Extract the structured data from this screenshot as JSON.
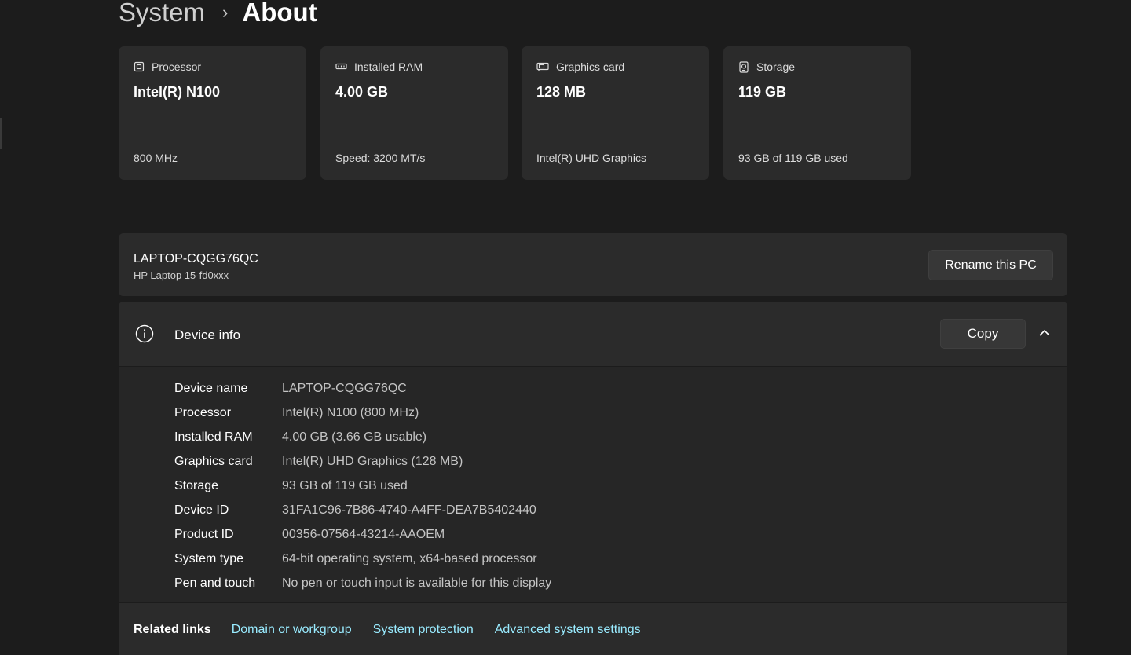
{
  "breadcrumb": {
    "parent": "System",
    "separator": "›",
    "current": "About"
  },
  "cards": [
    {
      "icon": "processor-icon",
      "title": "Processor",
      "value": "Intel(R) N100",
      "sub": "800 MHz"
    },
    {
      "icon": "ram-icon",
      "title": "Installed RAM",
      "value": "4.00 GB",
      "sub": "Speed: 3200 MT/s"
    },
    {
      "icon": "graphics-card-icon",
      "title": "Graphics card",
      "value": "128 MB",
      "sub": "Intel(R) UHD Graphics"
    },
    {
      "icon": "storage-icon",
      "title": "Storage",
      "value": "119 GB",
      "sub": "93 GB of 119 GB used"
    }
  ],
  "pc": {
    "name": "LAPTOP-CQGG76QC",
    "model": "HP Laptop 15-fd0xxx",
    "rename_label": "Rename this PC"
  },
  "device_info": {
    "title": "Device info",
    "copy_label": "Copy",
    "rows": [
      {
        "label": "Device name",
        "value": "LAPTOP-CQGG76QC"
      },
      {
        "label": "Processor",
        "value": "Intel(R) N100 (800 MHz)"
      },
      {
        "label": "Installed RAM",
        "value": "4.00 GB (3.66 GB usable)"
      },
      {
        "label": "Graphics card",
        "value": "Intel(R) UHD Graphics (128 MB)"
      },
      {
        "label": "Storage",
        "value": "93 GB of 119 GB used"
      },
      {
        "label": "Device ID",
        "value": "31FA1C96-7B86-4740-A4FF-DEA7B5402440"
      },
      {
        "label": "Product ID",
        "value": "00356-07564-43214-AAOEM"
      },
      {
        "label": "System type",
        "value": "64-bit operating system, x64-based processor"
      },
      {
        "label": "Pen and touch",
        "value": "No pen or touch input is available for this display"
      }
    ]
  },
  "related_links": {
    "label": "Related links",
    "links": [
      "Domain or workgroup",
      "System protection",
      "Advanced system settings"
    ]
  },
  "colors": {
    "background": "#1c1c1c",
    "card": "#2b2b2b",
    "link": "#99ebff"
  }
}
